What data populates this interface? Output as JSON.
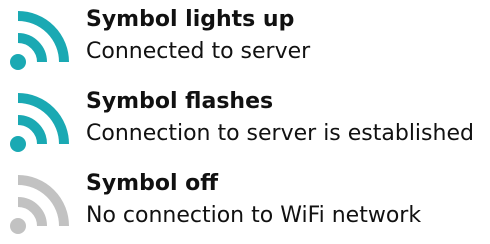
{
  "colors": {
    "active": "#1aa9b3",
    "off": "#c2c2c2",
    "text": "#111111"
  },
  "legend": [
    {
      "title": "Symbol lights up",
      "description": "Connected to server",
      "icon": "wifi-signal-icon",
      "state": "on"
    },
    {
      "title": "Symbol flashes",
      "description": "Connection to server is established",
      "icon": "wifi-signal-icon",
      "state": "flashing"
    },
    {
      "title": "Symbol off",
      "description": "No connection to WiFi network",
      "icon": "wifi-signal-icon",
      "state": "off"
    }
  ]
}
